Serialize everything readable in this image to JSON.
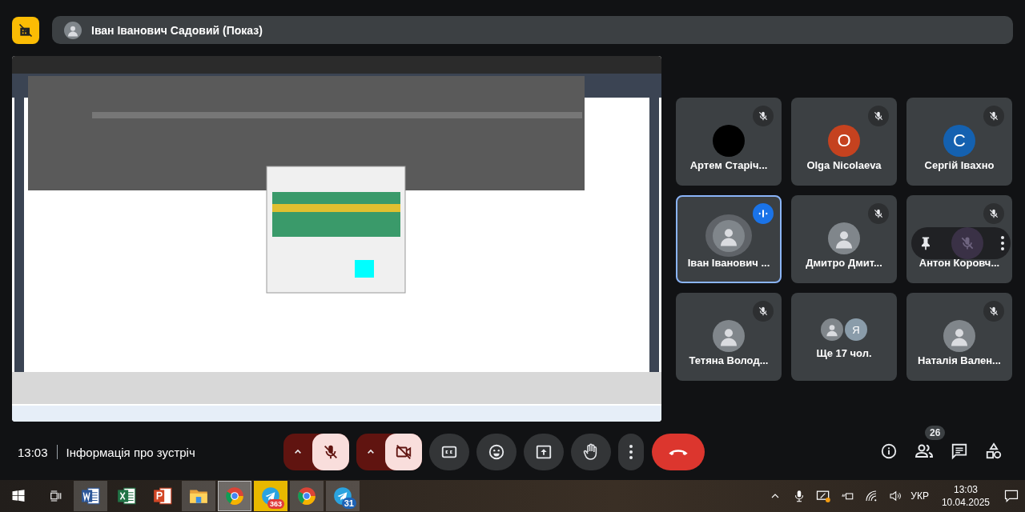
{
  "top_bar": {
    "presenter": "Іван Іванович Садовий (Показ)"
  },
  "participants": [
    {
      "kind": "person",
      "name": "Артем Старіч...",
      "avatar": {
        "kind": "plain",
        "color": "#000000"
      },
      "muted": true,
      "speaking": false,
      "hovered": false
    },
    {
      "kind": "person",
      "name": "Olga Nicolaeva",
      "avatar": {
        "kind": "letter",
        "initial": "O",
        "color": "#c5421f"
      },
      "muted": true,
      "speaking": false,
      "hovered": false
    },
    {
      "kind": "person",
      "name": "Сергій Івахно",
      "avatar": {
        "kind": "letter",
        "initial": "С",
        "color": "#1461b0"
      },
      "muted": true,
      "speaking": false,
      "hovered": false
    },
    {
      "kind": "person",
      "name": "Іван Іванович ...",
      "muted": false,
      "speaking": true,
      "hovered": false
    },
    {
      "kind": "person",
      "name": "Дмитро Дмит...",
      "muted": true,
      "speaking": false,
      "hovered": false
    },
    {
      "kind": "person",
      "name": "Антон Коровч...",
      "muted": true,
      "speaking": false,
      "hovered": true
    },
    {
      "kind": "person",
      "name": "Тетяна Волод...",
      "muted": true,
      "speaking": false,
      "hovered": false
    },
    {
      "kind": "others",
      "name": "Ще 17 чол.",
      "initial": "Я",
      "color": "#8a9caa"
    },
    {
      "kind": "person",
      "name": "Наталія Вален...",
      "muted": true,
      "speaking": false,
      "hovered": false
    }
  ],
  "call_bar": {
    "clock": "13:03",
    "meeting_info": "Інформація про зустріч",
    "mic_off": true,
    "camera_off": true,
    "people_count": "26"
  },
  "taskbar": {
    "apps": [
      {
        "kind": "word",
        "running": true,
        "selected": false
      },
      {
        "kind": "excel",
        "running": false,
        "selected": false
      },
      {
        "kind": "powerpoint",
        "running": false,
        "selected": false
      },
      {
        "kind": "folder",
        "running": true,
        "selected": false
      },
      {
        "kind": "chrome",
        "running": true,
        "selected": true
      },
      {
        "kind": "telegram",
        "running": true,
        "selected": false,
        "flashing": true,
        "badge": "363"
      },
      {
        "kind": "chrome",
        "running": true,
        "selected": false
      },
      {
        "kind": "telegram",
        "running": true,
        "selected": false,
        "badge": "31"
      }
    ],
    "language": "УКР",
    "time": "13:03",
    "date": "10.04.2025"
  }
}
